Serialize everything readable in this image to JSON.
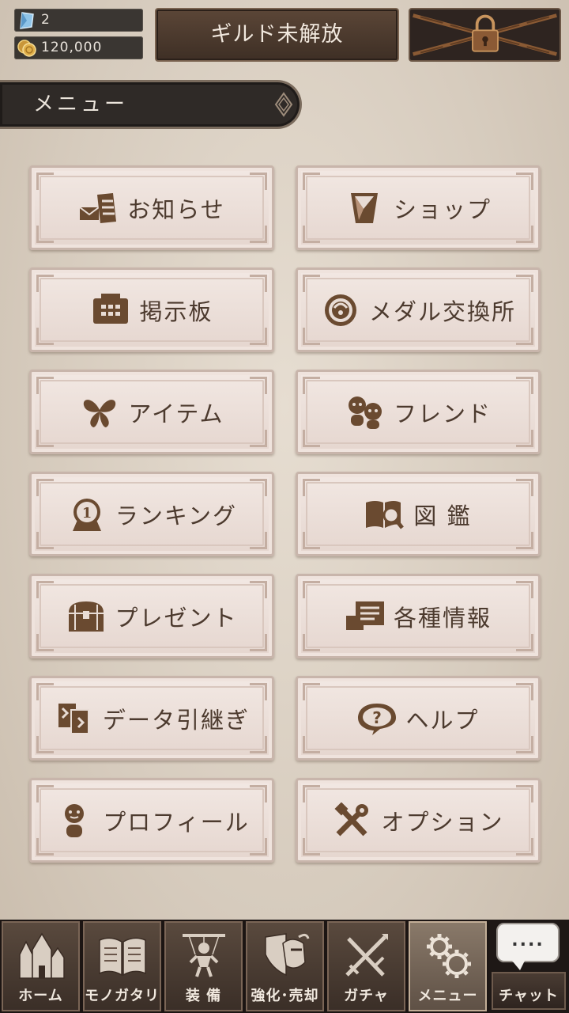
{
  "header": {
    "gems": "2",
    "gold": "120,000",
    "guild_label": "ギルド未解放",
    "locked_icon": "padlock-chains-icon"
  },
  "menu_title": "メニュー",
  "menu": {
    "buttons": [
      {
        "label": "お知らせ",
        "icon": "notice-letters-icon"
      },
      {
        "label": "ショップ",
        "icon": "shop-crystal-icon"
      },
      {
        "label": "掲示板",
        "icon": "bulletin-board-icon"
      },
      {
        "label": "メダル交換所",
        "icon": "medal-exchange-icon"
      },
      {
        "label": "アイテム",
        "icon": "butterfly-item-icon"
      },
      {
        "label": "フレンド",
        "icon": "friends-icon"
      },
      {
        "label": "ランキング",
        "icon": "ranking-medal-icon"
      },
      {
        "label": "図 鑑",
        "icon": "book-magnifier-icon"
      },
      {
        "label": "プレゼント",
        "icon": "treasure-chest-icon"
      },
      {
        "label": "各種情報",
        "icon": "info-stack-icon"
      },
      {
        "label": "データ引継ぎ",
        "icon": "data-transfer-icon"
      },
      {
        "label": "ヘルプ",
        "icon": "help-question-icon"
      },
      {
        "label": "プロフィール",
        "icon": "profile-icon"
      },
      {
        "label": "オプション",
        "icon": "tools-icon"
      }
    ]
  },
  "bottom_nav": {
    "items": [
      {
        "label": "ホーム",
        "icon": "castle-icon"
      },
      {
        "label": "モノガタリ",
        "icon": "open-book-icon"
      },
      {
        "label": "装 備",
        "icon": "puppet-icon"
      },
      {
        "label": "強化･売却",
        "icon": "shield-helmet-icon"
      },
      {
        "label": "ガチャ",
        "icon": "crossed-swords-icon"
      },
      {
        "label": "メニュー",
        "icon": "gears-icon"
      }
    ],
    "chat_label": "チャット",
    "chat_dots": "....",
    "active_index": 5
  },
  "colors": {
    "background": "#d9cfc2",
    "button_face": "#f2e8e3",
    "text_brown": "#4c3a2e",
    "dark_panel": "#2f2a27"
  }
}
